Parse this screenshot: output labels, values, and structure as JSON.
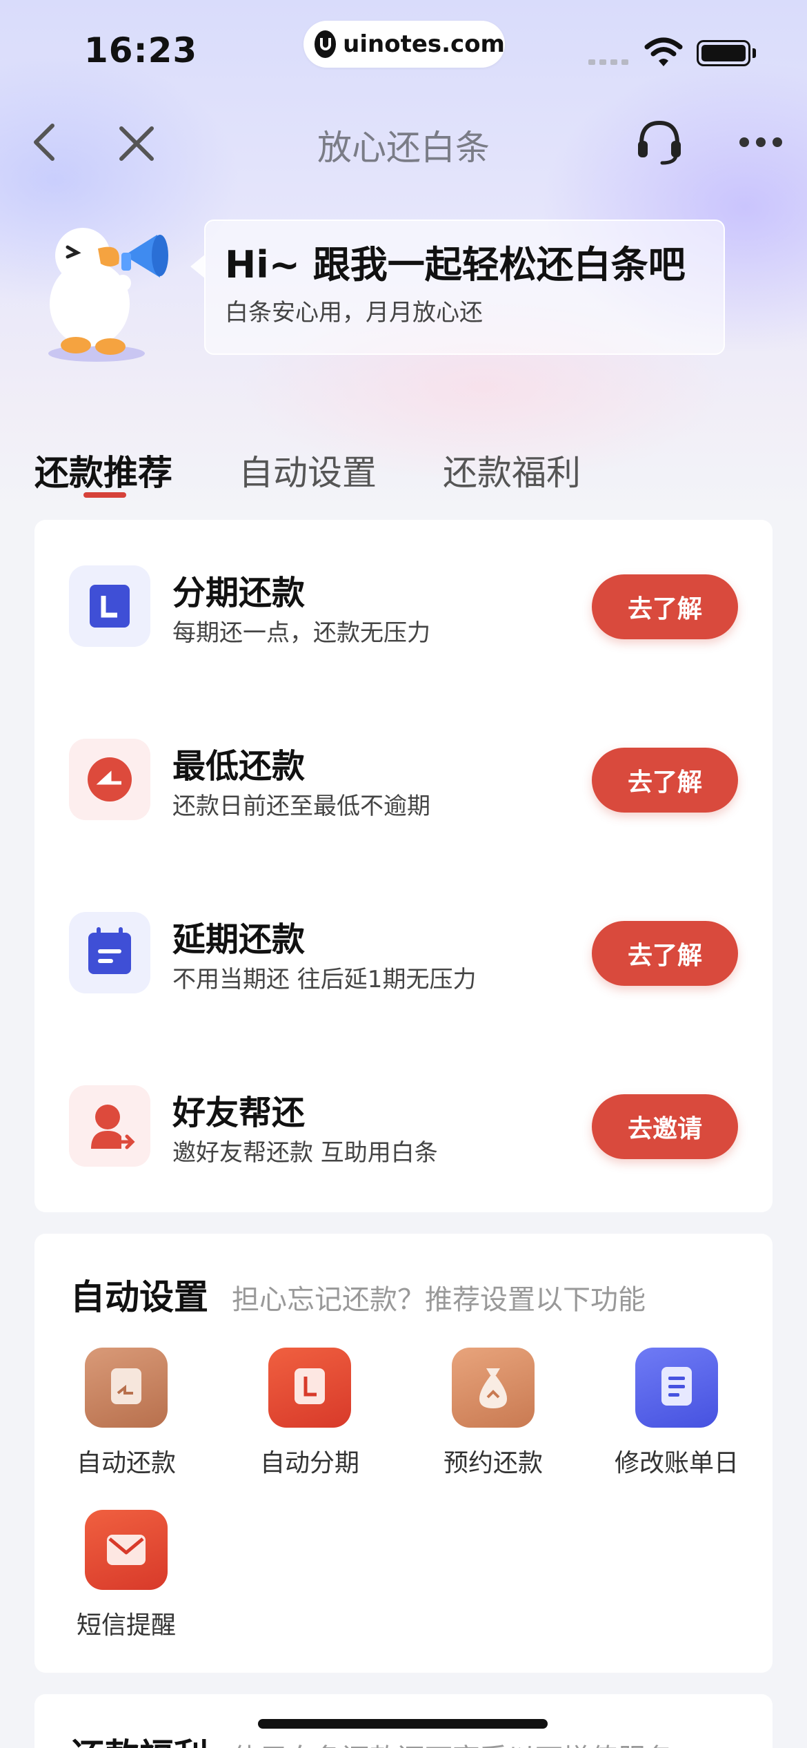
{
  "status_bar": {
    "time": "16:23",
    "url": "uinotes.com"
  },
  "nav": {
    "title": "放心还白条",
    "back_icon": "chevron-left-icon",
    "close_icon": "close-icon",
    "service_icon": "headset-icon",
    "more_icon": "more-dots-icon"
  },
  "greeting": {
    "title": "Hi~ 跟我一起轻松还白条吧",
    "subtitle": "白条安心用，月月放心还"
  },
  "tabs": [
    {
      "label": "还款推荐",
      "active": true
    },
    {
      "label": "自动设置",
      "active": false
    },
    {
      "label": "还款福利",
      "active": false
    }
  ],
  "repay_options": [
    {
      "title": "分期还款",
      "subtitle": "每期还一点，还款无压力",
      "button": "去了解",
      "icon": "installment-icon"
    },
    {
      "title": "最低还款",
      "subtitle": "还款日前还至最低不逾期",
      "button": "去了解",
      "icon": "minimum-pie-icon"
    },
    {
      "title": "延期还款",
      "subtitle": "不用当期还 往后延1期无压力",
      "button": "去了解",
      "icon": "calendar-icon"
    },
    {
      "title": "好友帮还",
      "subtitle": "邀好友帮还款 互助用白条",
      "button": "去邀请",
      "icon": "friend-share-icon"
    }
  ],
  "auto_settings": {
    "title": "自动设置",
    "subtitle": "担心忘记还款？推荐设置以下功能",
    "items": [
      {
        "label": "自动还款",
        "icon": "auto-repay-icon"
      },
      {
        "label": "自动分期",
        "icon": "auto-installment-icon"
      },
      {
        "label": "预约还款",
        "icon": "money-bag-icon"
      },
      {
        "label": "修改账单日",
        "icon": "bill-date-icon"
      },
      {
        "label": "短信提醒",
        "icon": "sms-mail-icon"
      }
    ]
  },
  "benefits": {
    "title": "还款福利",
    "subtitle": "使用白条还款还可享受以下增值服务"
  },
  "colors": {
    "accent_red": "#d94a3d",
    "accent_blue": "#4d5de0"
  }
}
